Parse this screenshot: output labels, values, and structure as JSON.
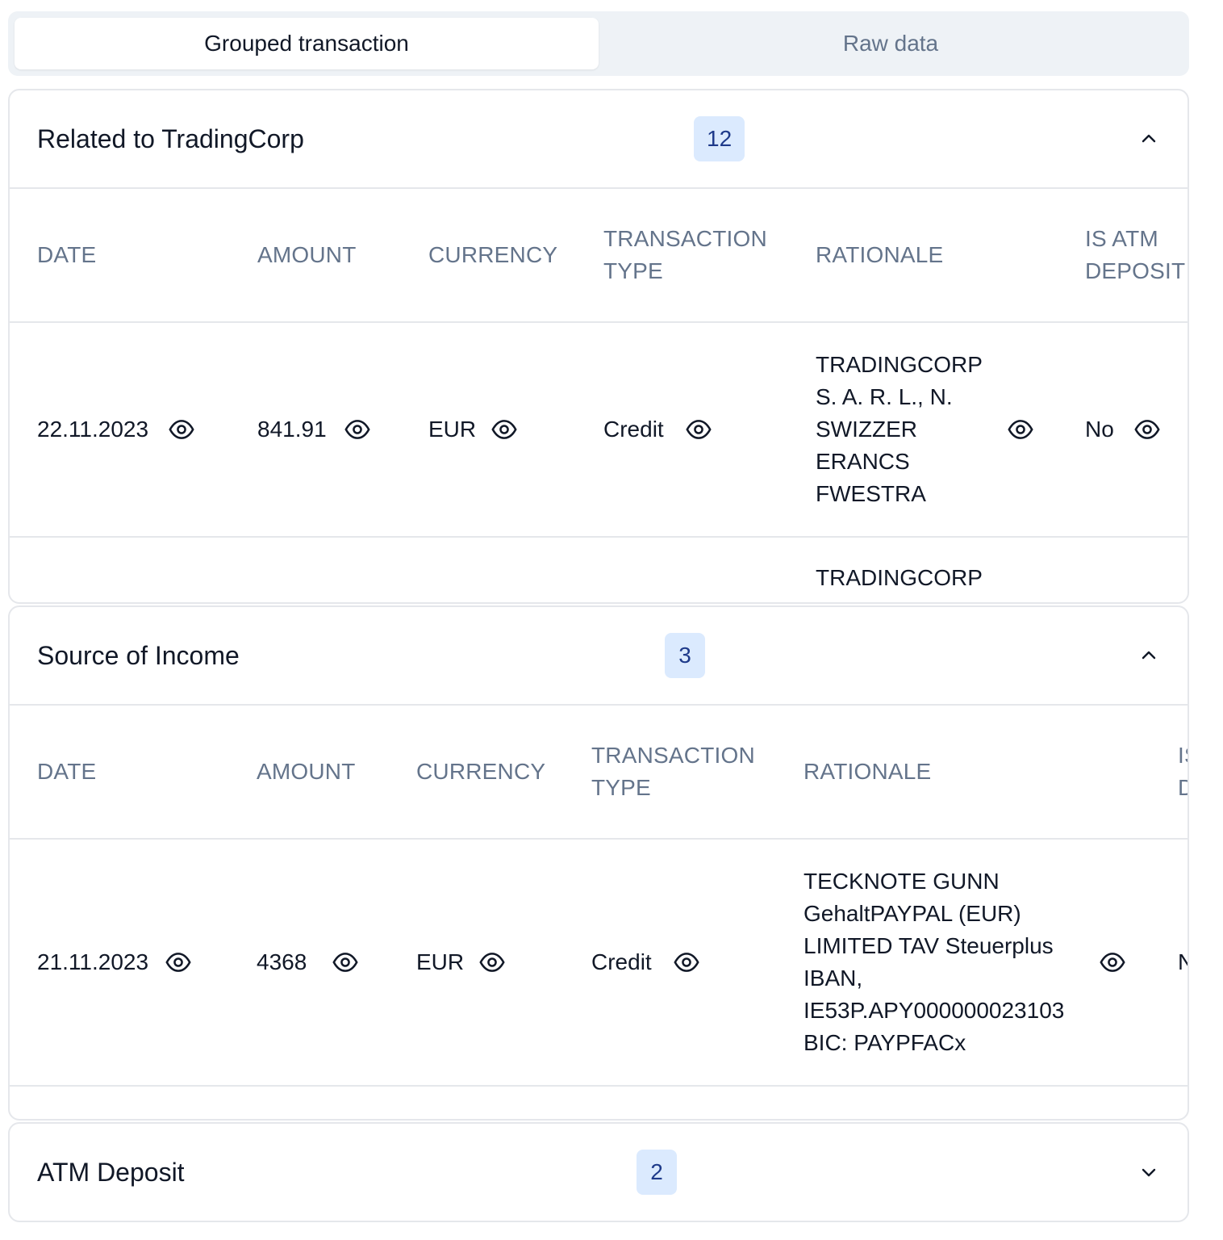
{
  "tabs": [
    {
      "label": "Grouped transaction",
      "active": true
    },
    {
      "label": "Raw data",
      "active": false
    }
  ],
  "columns": [
    "DATE",
    "AMOUNT",
    "CURRENCY",
    "TRANSACTION\nTYPE",
    "RATIONALE",
    "IS ATM\nDEPOSIT"
  ],
  "groups": [
    {
      "title": "Related to TradingCorp",
      "count": "12",
      "expanded": true,
      "rows": [
        {
          "date": "22.11.2023",
          "amount": "841.91",
          "currency": "EUR",
          "type": "Credit",
          "rationale": "TRADINGCORP\nS. A. R. L., N.\nSWIZZER\nERANCS\nFWESTRA",
          "atm": "No"
        },
        {
          "date": "",
          "amount": "",
          "currency": "",
          "type": "",
          "rationale": "TRADINGCORP",
          "atm": ""
        }
      ]
    },
    {
      "title": "Source of Income",
      "count": "3",
      "expanded": true,
      "rows": [
        {
          "date": "21.11.2023",
          "amount": "4368",
          "currency": "EUR",
          "type": "Credit",
          "rationale": "TECKNOTE GUNN\nGehaltPAYPAL (EUR)\nLIMITED TAV Steuerplus\nIBAN,\nIE53P.APY000000023103\nBIC: PAYPFACx",
          "atm": "No"
        }
      ]
    },
    {
      "title": "ATM Deposit",
      "count": "2",
      "expanded": false,
      "rows": []
    }
  ],
  "icons": {
    "eye": "eye-icon",
    "expanded": "chevron-up-icon",
    "collapsed": "chevron-down-icon"
  }
}
